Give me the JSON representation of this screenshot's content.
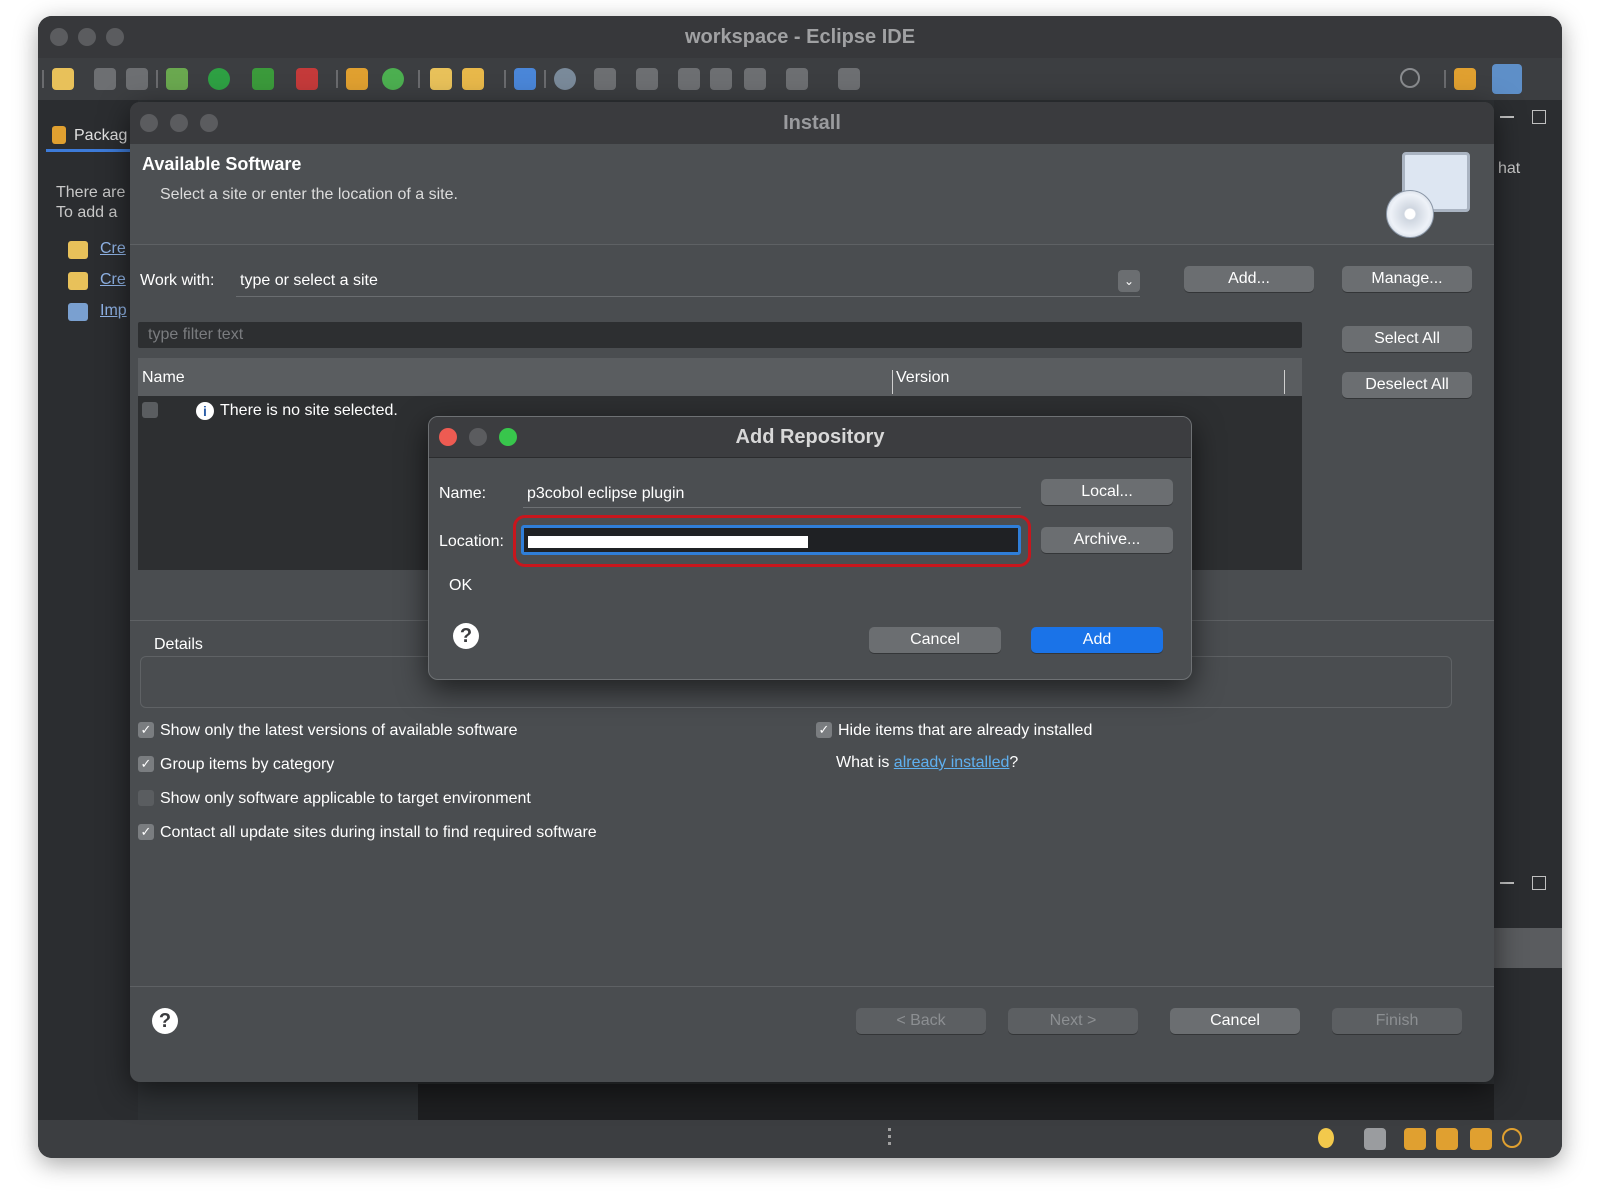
{
  "window": {
    "title": "workspace - Eclipse IDE"
  },
  "left_panel": {
    "tab_label": "Packag",
    "text_line1": "There are",
    "text_line2": "To add a",
    "links": [
      "Cre",
      "Cre",
      "Imp"
    ]
  },
  "right_panel": {
    "partial_text": "hat"
  },
  "install_dialog": {
    "title": "Install",
    "heading": "Available Software",
    "subheading": "Select a site or enter the location of a site.",
    "work_with_label": "Work with:",
    "work_with_value": "type or select a site",
    "add_button": "Add...",
    "manage_button": "Manage...",
    "filter_placeholder": "type filter text",
    "select_all_button": "Select All",
    "deselect_all_button": "Deselect All",
    "table": {
      "col_name": "Name",
      "col_version": "Version",
      "empty_message": "There is no site selected."
    },
    "details_label": "Details",
    "options": [
      {
        "label": "Show only the latest versions of available software",
        "checked": true
      },
      {
        "label": "Group items by category",
        "checked": true
      },
      {
        "label": "Show only software applicable to target environment",
        "checked": false
      },
      {
        "label": "Contact all update sites during install to find required software",
        "checked": true
      }
    ],
    "hide_installed": {
      "label": "Hide items that are already installed",
      "checked": true
    },
    "what_is_prefix": "What is ",
    "what_is_link": "already installed",
    "what_is_suffix": "?",
    "back_button": "< Back",
    "next_button": "Next >",
    "cancel_button": "Cancel",
    "finish_button": "Finish"
  },
  "add_repository": {
    "title": "Add Repository",
    "name_label": "Name:",
    "name_value": "p3cobol eclipse plugin",
    "location_label": "Location:",
    "status_text": "OK",
    "local_button": "Local...",
    "archive_button": "Archive...",
    "cancel_button": "Cancel",
    "add_button": "Add"
  },
  "colors": {
    "accent_blue": "#1a73e8",
    "highlight_red": "#c8161d",
    "link_blue": "#5fb0f0"
  }
}
